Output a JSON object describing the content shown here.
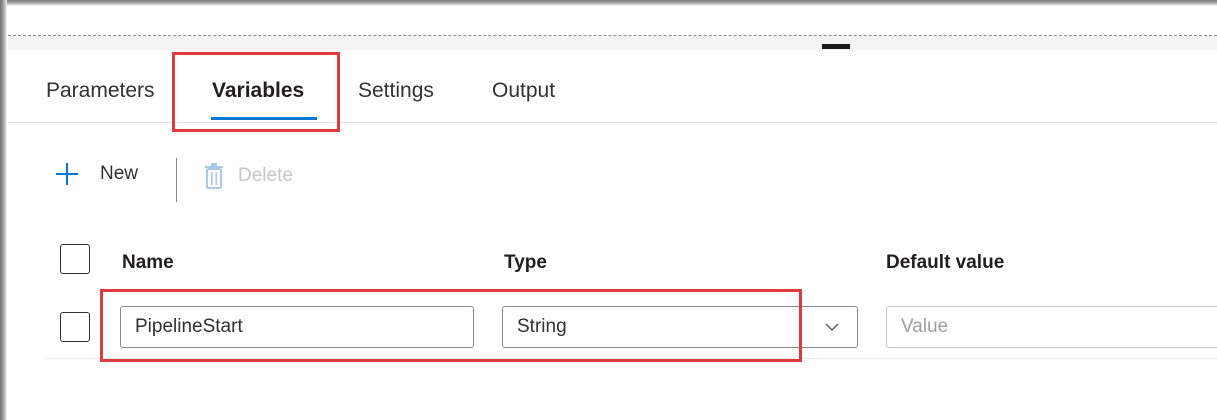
{
  "tabs": [
    {
      "label": "Parameters"
    },
    {
      "label": "Variables"
    },
    {
      "label": "Settings"
    },
    {
      "label": "Output"
    }
  ],
  "active_tab": "Variables",
  "toolbar": {
    "new_label": "New",
    "delete_label": "Delete"
  },
  "table": {
    "columns": [
      "Name",
      "Type",
      "Default value"
    ],
    "rows": [
      {
        "name": "PipelineStart",
        "type": "String",
        "default_value": "",
        "default_value_placeholder": "Value"
      }
    ]
  },
  "colors": {
    "accent": "#0078d4",
    "highlight_box": "#e0393e"
  },
  "icons": {
    "add": "plus-icon",
    "delete": "trash-icon",
    "dropdown": "chevron-down-icon"
  }
}
